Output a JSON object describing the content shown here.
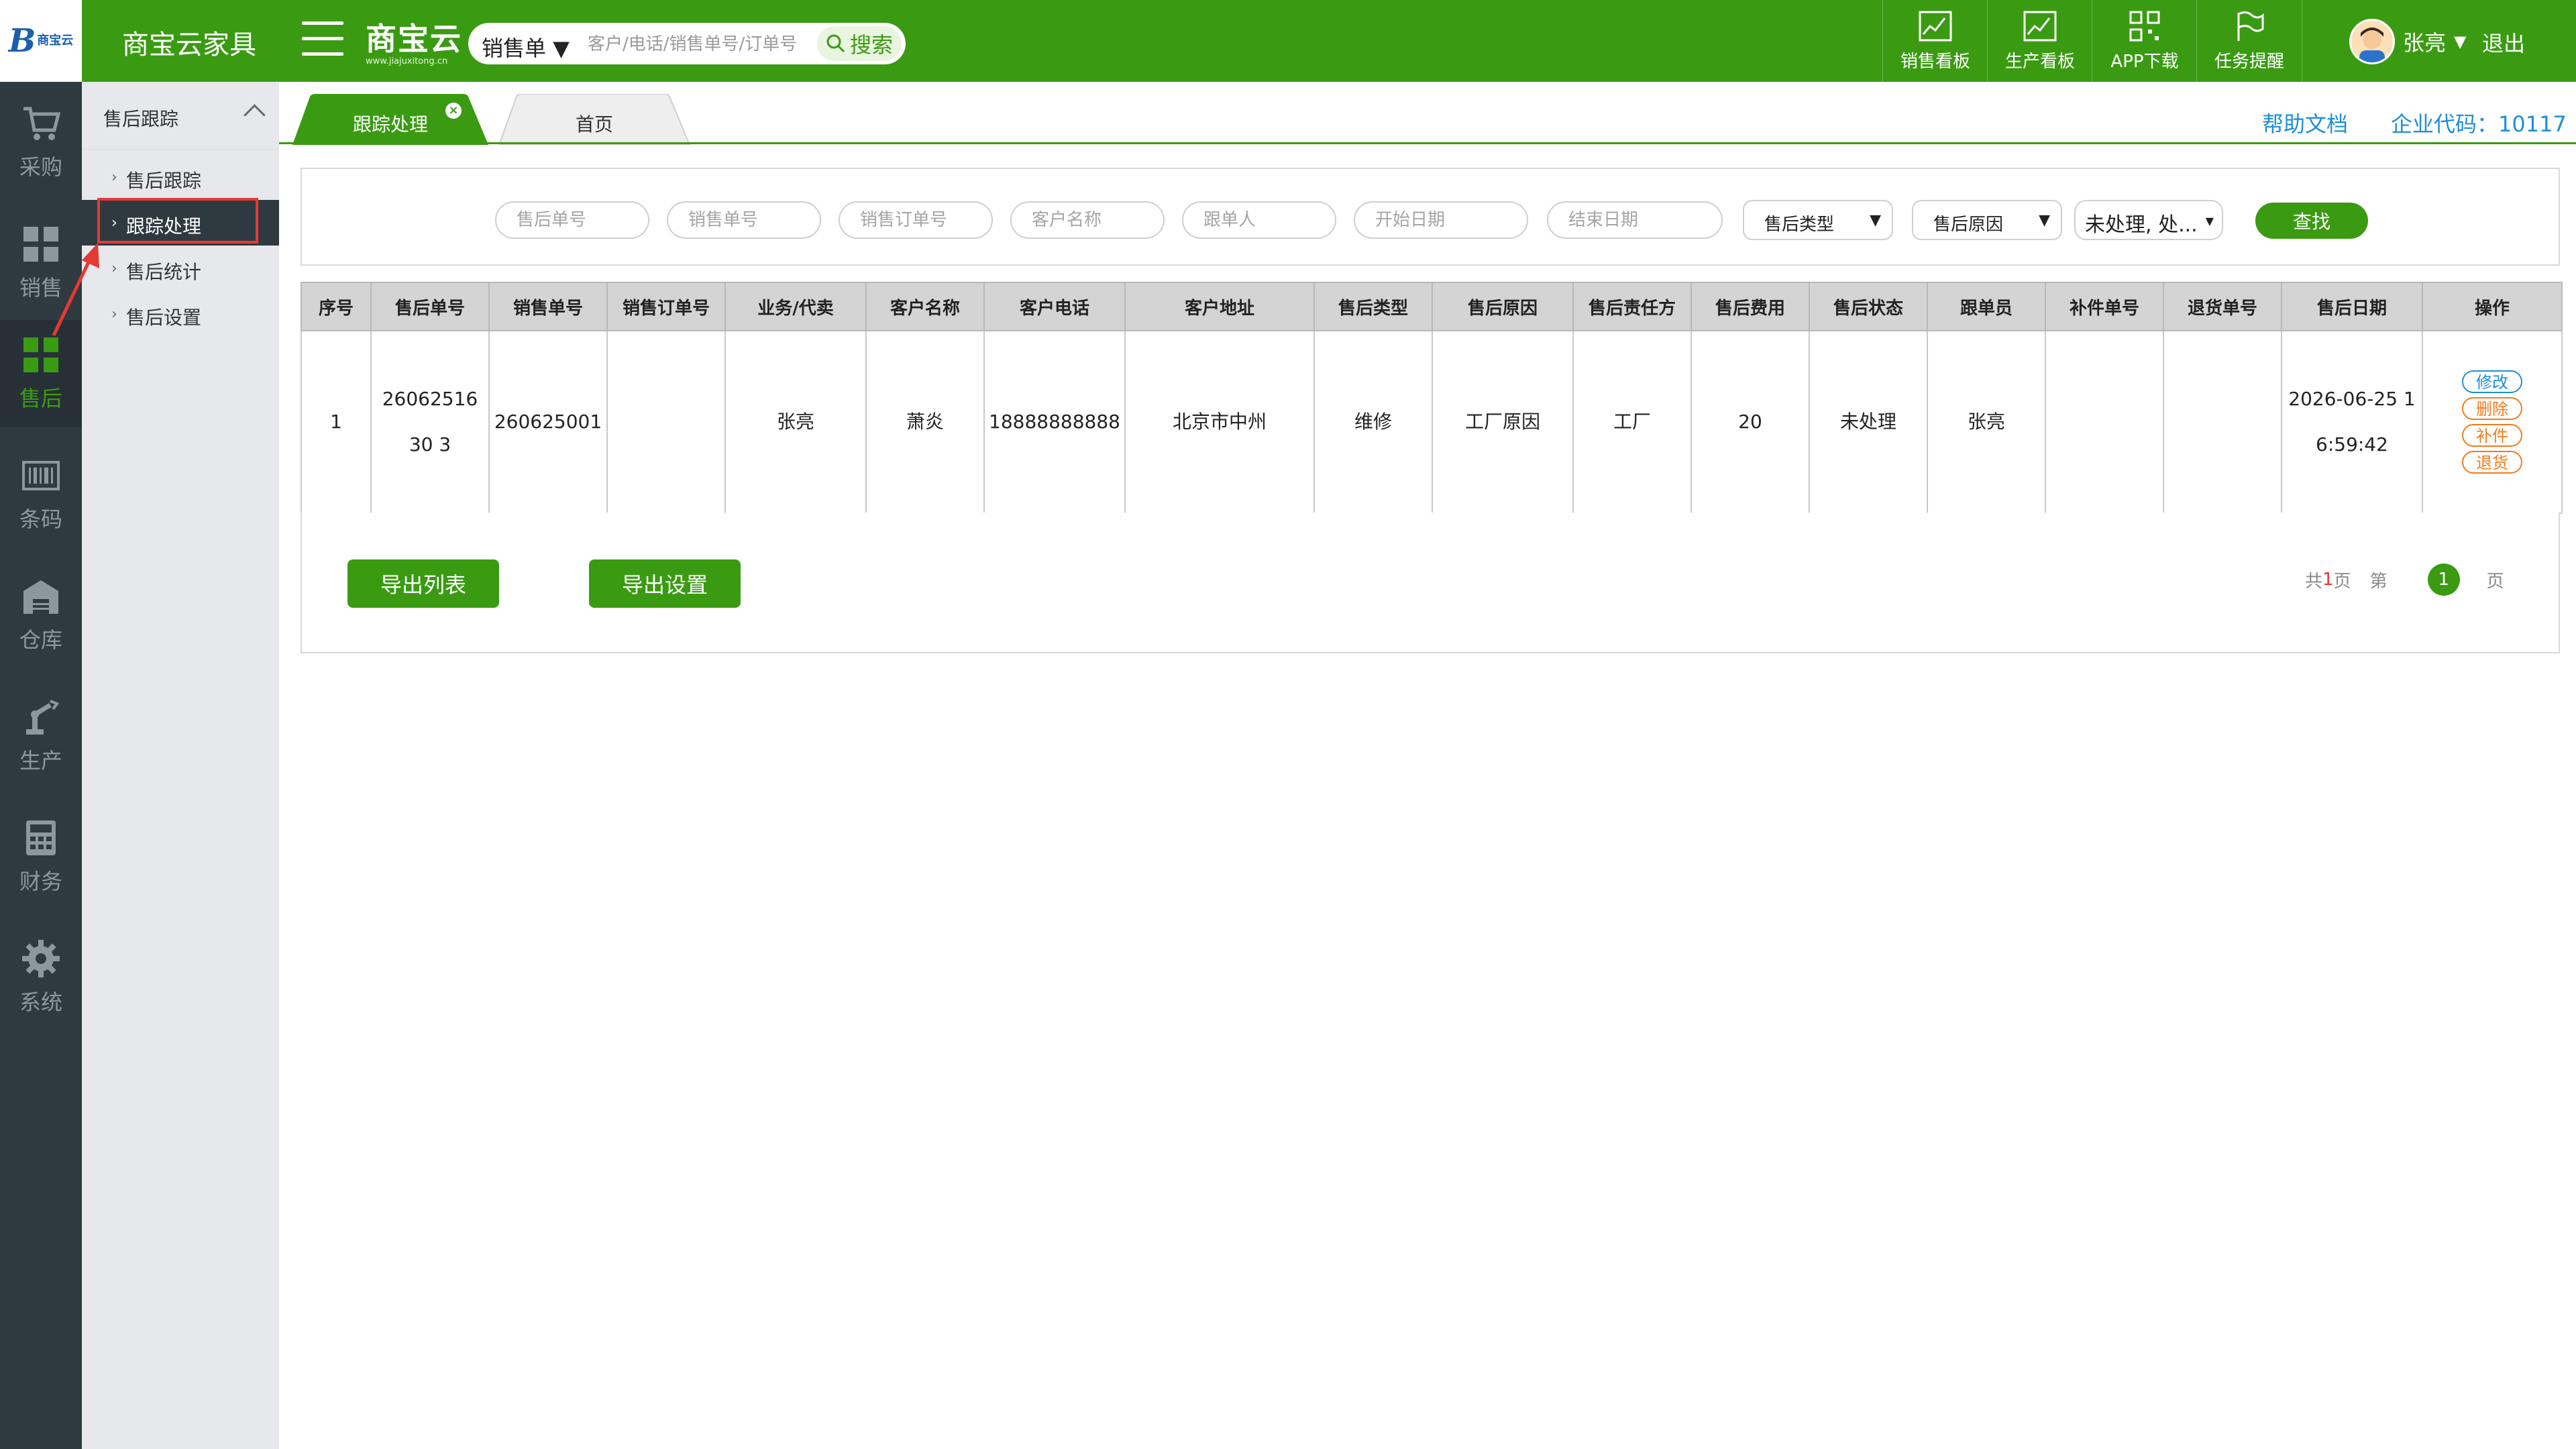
{
  "colors": {
    "brand_green": "#3a9b12",
    "sidebar_dark": "#2f3a40",
    "link_blue": "#1e8fd6",
    "warn_orange": "#f07c1e",
    "highlight_red": "#e53935"
  },
  "topbar": {
    "logo_text": "商宝云",
    "app_title": "商宝云家具",
    "brand_name": "商宝云",
    "brand_url": "www.jiajuxitong.cn",
    "search_type": "销售单",
    "search_placeholder": "客户/电话/销售单号/订单号",
    "search_button": "搜索",
    "nav": [
      {
        "label": "销售看板",
        "icon": "chart-icon"
      },
      {
        "label": "生产看板",
        "icon": "chart-icon"
      },
      {
        "label": "APP下载",
        "icon": "qrcode-icon"
      },
      {
        "label": "任务提醒",
        "icon": "flag-icon"
      }
    ],
    "user_name": "张亮",
    "logout": "退出"
  },
  "modules": [
    {
      "label": "采购",
      "icon": "cart-icon"
    },
    {
      "label": "销售",
      "icon": "grid-icon"
    },
    {
      "label": "售后",
      "icon": "grid-icon",
      "active": true
    },
    {
      "label": "条码",
      "icon": "barcode-icon"
    },
    {
      "label": "仓库",
      "icon": "warehouse-icon"
    },
    {
      "label": "生产",
      "icon": "robot-arm-icon"
    },
    {
      "label": "财务",
      "icon": "calculator-icon"
    },
    {
      "label": "系统",
      "icon": "gear-icon"
    }
  ],
  "subnav": {
    "header": "售后跟踪",
    "items": [
      "售后跟踪",
      "跟踪处理",
      "售后统计",
      "售后设置"
    ],
    "active_index": 1
  },
  "tabs": {
    "items": [
      "跟踪处理",
      "首页"
    ],
    "active_index": 0,
    "close_glyph": "×"
  },
  "help_link": "帮助文档",
  "corp_code": "企业代码：10117",
  "filters": {
    "inputs": [
      "售后单号",
      "销售单号",
      "销售订单号",
      "客户名称",
      "跟单人",
      "开始日期",
      "结束日期"
    ],
    "selects": [
      "售后类型",
      "售后原因"
    ],
    "status_select": "未处理, 处...",
    "find_button": "查找"
  },
  "table": {
    "headers": [
      "序号",
      "售后单号",
      "销售单号",
      "销售订单号",
      "业务/代卖",
      "客户名称",
      "客户电话",
      "客户地址",
      "售后类型",
      "售后原因",
      "售后责任方",
      "售后费用",
      "售后状态",
      "跟单员",
      "补件单号",
      "退货单号",
      "售后日期",
      "操作"
    ],
    "rows": [
      {
        "cells": [
          "1",
          "2606251630 3",
          "260625001",
          "",
          "张亮",
          "萧炎",
          "18888888888",
          "北京市中州",
          "维修",
          "工厂原因",
          "工厂",
          "20",
          "未处理",
          "张亮",
          "",
          "",
          "2026-06-25 16:59:42"
        ],
        "actions": [
          "修改",
          "删除",
          "补件",
          "退货"
        ]
      }
    ]
  },
  "footer": {
    "export_list": "导出列表",
    "export_settings": "导出设置",
    "pager_total_prefix": "共",
    "pager_total_num": "1",
    "pager_total_suffix": "页",
    "pager_page_prefix": "第",
    "pager_current": "1",
    "pager_page_suffix": "页"
  }
}
